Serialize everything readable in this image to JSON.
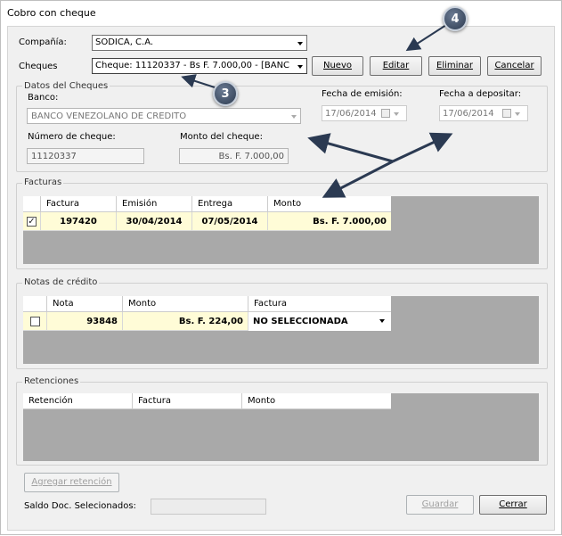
{
  "window": {
    "title": "Cobro con cheque"
  },
  "company": {
    "label": "Compañía:",
    "value": "SODICA, C.A."
  },
  "cheques": {
    "label": "Cheques",
    "value": "Cheque: 11120337 - Bs F. 7.000,00 - [BANC"
  },
  "buttons": {
    "nuevo": "Nuevo",
    "editar": "Editar",
    "eliminar": "Eliminar",
    "cancelar": "Cancelar",
    "agregar_retencion": "Agregar retención",
    "guardar": "Guardar",
    "cerrar": "Cerrar"
  },
  "datos": {
    "title": "Datos del Cheques",
    "banco_label": "Banco:",
    "banco_value": "BANCO VENEZOLANO DE CREDITO",
    "fecha_emision_label": "Fecha de emisión:",
    "fecha_emision_value": "17/06/2014",
    "fecha_depositar_label": "Fecha a depositar:",
    "fecha_depositar_value": "17/06/2014",
    "numero_label": "Número de cheque:",
    "numero_value": "11120337",
    "monto_label": "Monto del cheque:",
    "monto_value": "Bs. F. 7.000,00"
  },
  "facturas": {
    "title": "Facturas",
    "columns": [
      "Factura",
      "Emisión",
      "Entrega",
      "Monto"
    ],
    "rows": [
      {
        "checked": true,
        "factura": "197420",
        "emision": "30/04/2014",
        "entrega": "07/05/2014",
        "monto": "Bs. F. 7.000,00"
      }
    ]
  },
  "notas": {
    "title": "Notas de crédito",
    "columns": [
      "Nota",
      "Monto",
      "Factura"
    ],
    "rows": [
      {
        "checked": false,
        "nota": "93848",
        "monto": "Bs. F. 224,00",
        "factura": "NO SELECCIONADA"
      }
    ]
  },
  "retenciones": {
    "title": "Retenciones",
    "columns": [
      "Retención",
      "Factura",
      "Monto"
    ]
  },
  "saldo": {
    "label": "Saldo Doc. Selecionados:",
    "value": ""
  },
  "callouts": {
    "c3": "3",
    "c4": "4"
  }
}
